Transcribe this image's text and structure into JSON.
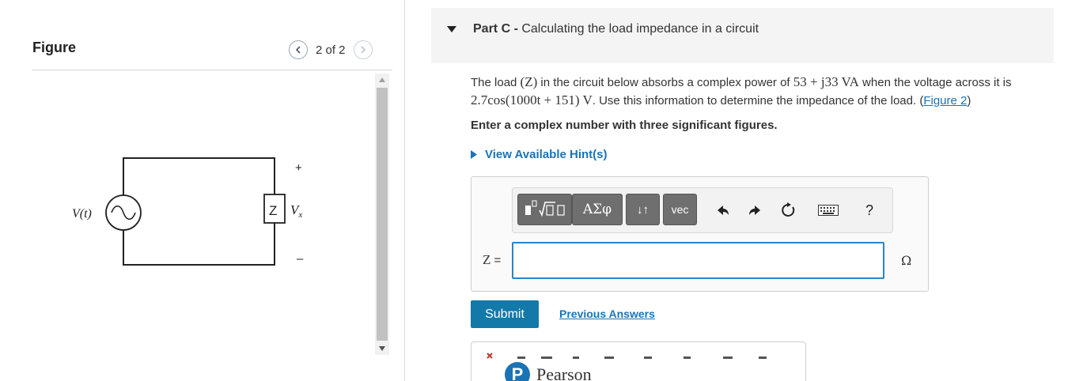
{
  "figure": {
    "title": "Figure",
    "counter": "2 of 2",
    "labels": {
      "source": "V(t)",
      "impedance": "Z",
      "voltage": "V",
      "voltage_sub": "x",
      "plus": "+",
      "minus": "–"
    }
  },
  "part": {
    "prefix": "Part C",
    "separator": " - ",
    "title": "Calculating the load impedance in a circuit"
  },
  "question": {
    "t1": "The load ",
    "z": "(Z)",
    "t2": " in the circuit below absorbs a complex power of ",
    "power": "53 + j33 VA",
    "t3": " when the voltage across it is ",
    "voltage": "2.7cos(1000t + 151) V",
    "t4": ". Use this information to determine the impedance of the load. (",
    "figure_link": "Figure 2",
    "t5": ")"
  },
  "instruction": "Enter a complex number with three significant figures.",
  "hint_label": "View Available Hint(s)",
  "toolbar": {
    "greek": "ΑΣφ",
    "arrows": "↓↑",
    "vec": "vec",
    "undo": "↶",
    "redo": "↷",
    "reset": "⟳",
    "keyboard": "keyboard",
    "help": "?"
  },
  "answer": {
    "label_var": "Z",
    "label_eq": " =",
    "value": "",
    "unit": "Ω"
  },
  "submit_label": "Submit",
  "previous_answers_label": "Previous Answers",
  "footer": {
    "logo_letter": "P",
    "brand": "Pearson"
  },
  "colors": {
    "accent": "#1279a9",
    "link": "#1a73b5",
    "input_border": "#2a84c6"
  }
}
